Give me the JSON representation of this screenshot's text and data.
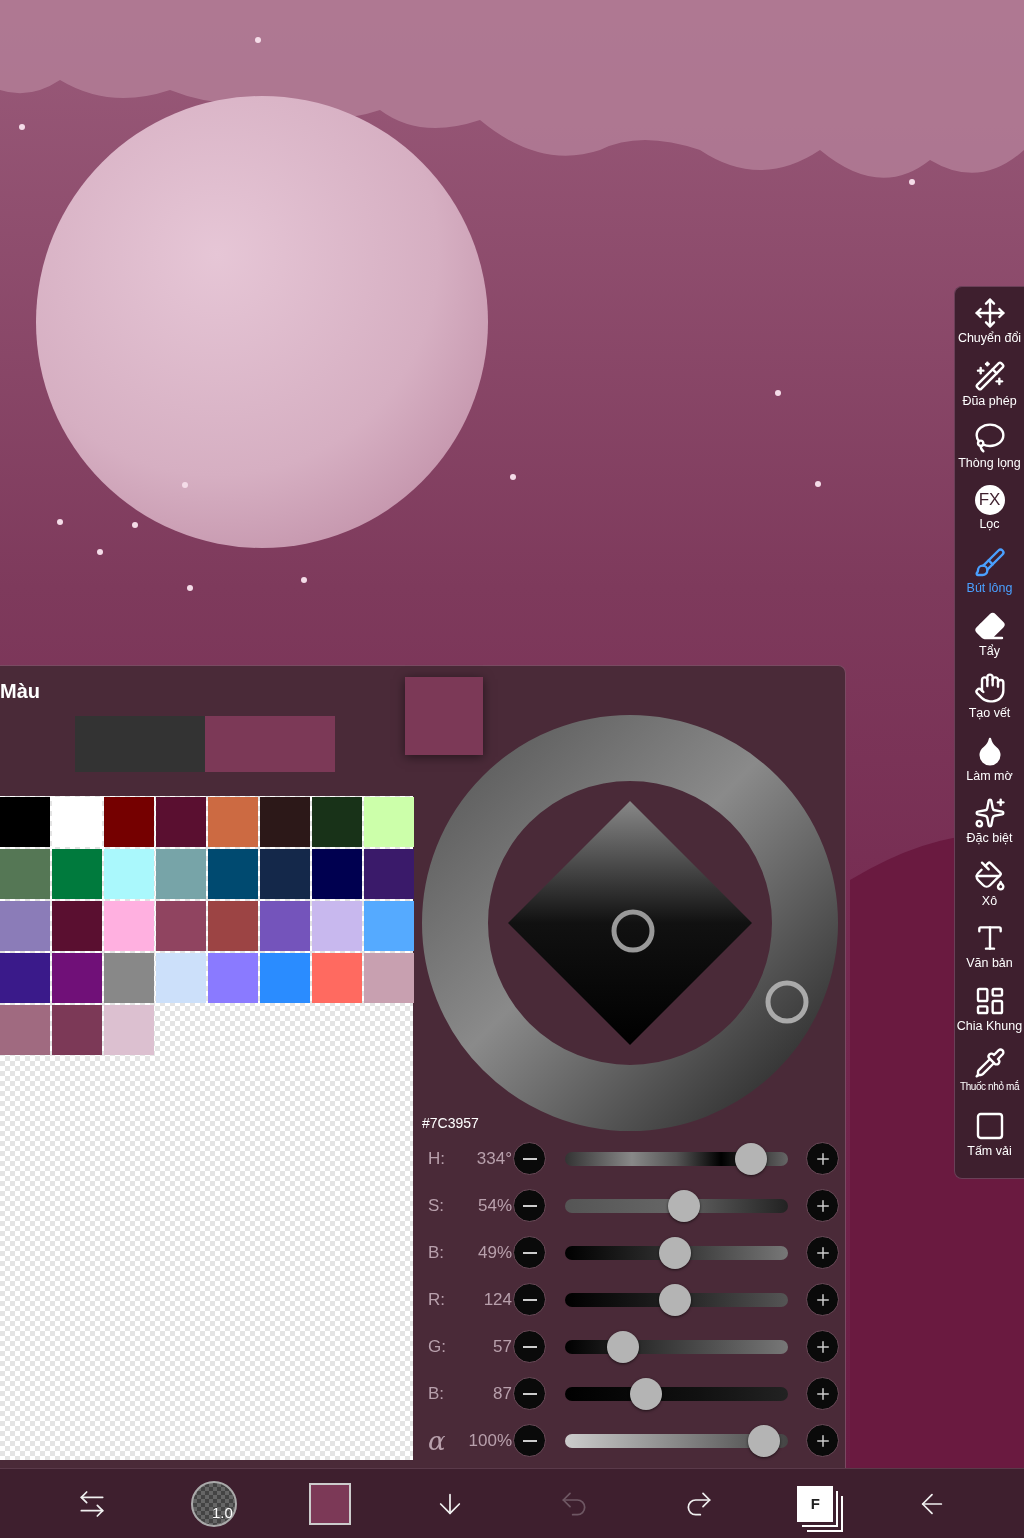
{
  "color_panel": {
    "title": "Màu",
    "compare_swatches": [
      {
        "color": "#333333"
      },
      {
        "color": "#7c3957"
      }
    ],
    "current_swatch": {
      "color": "#7c3957"
    },
    "palette": [
      {
        "color": "#000000"
      },
      {
        "color": "#ffffff"
      },
      {
        "color": "#750000"
      },
      {
        "color": "#5a0f30"
      },
      {
        "color": "#cc6a42"
      },
      {
        "color": "#2c1818"
      },
      {
        "color": "#183218"
      },
      {
        "color": "#ccffaa"
      },
      {
        "color": "#557755"
      },
      {
        "color": "#007a3d"
      },
      {
        "color": "#aaf8fc"
      },
      {
        "color": "#77a4a8"
      },
      {
        "color": "#004a70"
      },
      {
        "color": "#14284a"
      },
      {
        "color": "#000050"
      },
      {
        "color": "#3a1a6a"
      },
      {
        "color": "#8b7cb8"
      },
      {
        "color": "#5a0f30"
      },
      {
        "color": "#ffb0e0"
      },
      {
        "color": "#904460"
      },
      {
        "color": "#9c4444"
      },
      {
        "color": "#7454bb"
      },
      {
        "color": "#c8b8ee"
      },
      {
        "color": "#55aaff"
      },
      {
        "color": "#3a1a8a"
      },
      {
        "color": "#701078"
      },
      {
        "color": "#888888"
      },
      {
        "color": "#cce0fa"
      },
      {
        "color": "#8a7aff"
      },
      {
        "color": "#2a8cff"
      },
      {
        "color": "#ff6a60"
      },
      {
        "color": "#c8a0b0"
      },
      {
        "color": "#a06a80"
      },
      {
        "color": "#7c3957"
      },
      {
        "color": "#dcc0d0"
      }
    ],
    "hex": "#7C3957",
    "sliders": [
      {
        "kind": "hue",
        "label": "H:",
        "value": "334°",
        "level": 0.89
      },
      {
        "kind": "saturation",
        "label": "S:",
        "value": "54%",
        "level": 0.54
      },
      {
        "kind": "brightness",
        "label": "B:",
        "value": "49%",
        "level": 0.49
      },
      {
        "kind": "red",
        "label": "R:",
        "value": "124",
        "level": 0.49
      },
      {
        "kind": "green",
        "label": "G:",
        "value": "57",
        "level": 0.22
      },
      {
        "kind": "blue",
        "label": "B:",
        "value": "87",
        "level": 0.34
      },
      {
        "kind": "alpha",
        "label": "α",
        "value": "100%",
        "level": 0.96
      }
    ]
  },
  "tools": [
    {
      "kind": "move",
      "label": "Chuyển đổi",
      "selected": false
    },
    {
      "kind": "wand",
      "label": "Đũa phép",
      "selected": false
    },
    {
      "kind": "lasso",
      "label": "Thòng lọng",
      "selected": false
    },
    {
      "kind": "filter",
      "glyph": "FX",
      "label": "Lọc",
      "selected": false
    },
    {
      "kind": "brush",
      "label": "Bút lông",
      "selected": true
    },
    {
      "kind": "eraser",
      "label": "Tẩy",
      "selected": false
    },
    {
      "kind": "smudge",
      "label": "Tạo vết",
      "selected": false
    },
    {
      "kind": "blur",
      "label": "Làm mờ",
      "selected": false
    },
    {
      "kind": "special",
      "label": "Đặc biệt",
      "selected": false
    },
    {
      "kind": "bucket",
      "label": "Xô",
      "selected": false
    },
    {
      "kind": "text",
      "label": "Văn bản",
      "selected": false
    },
    {
      "kind": "frame",
      "label": "Chia Khung",
      "selected": false
    },
    {
      "kind": "dropper",
      "label": "Thuốc nhỏ mắ",
      "selected": false
    },
    {
      "kind": "canvas",
      "label": "Tấm vải",
      "selected": false
    }
  ],
  "bottom_bar": [
    {
      "kind": "swap",
      "disabled": false
    },
    {
      "kind": "brush_size",
      "text": "1.0",
      "disabled": false
    },
    {
      "kind": "color",
      "color": "#7c3957",
      "disabled": false
    },
    {
      "kind": "download",
      "disabled": false
    },
    {
      "kind": "undo",
      "disabled": true
    },
    {
      "kind": "redo",
      "disabled": false
    },
    {
      "kind": "layers",
      "text": "F",
      "disabled": false
    },
    {
      "kind": "back",
      "disabled": false
    }
  ]
}
